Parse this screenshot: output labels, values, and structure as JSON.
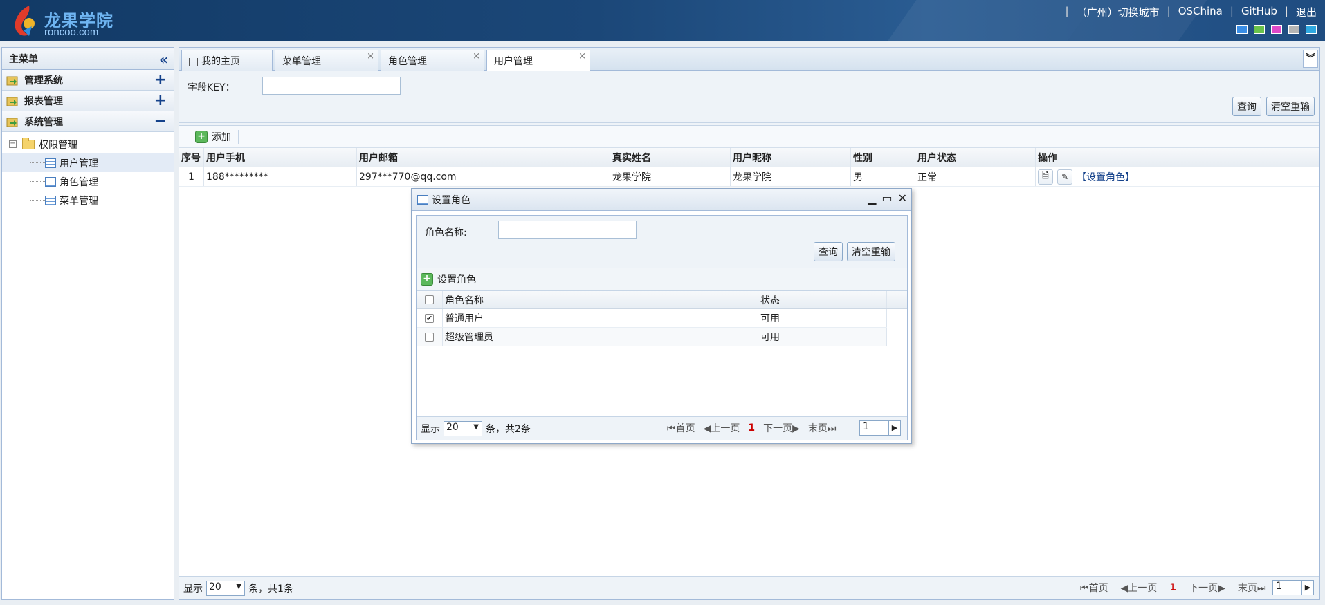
{
  "header": {
    "logo_cn": "龙果学院",
    "logo_en": "roncoo.com",
    "nav": [
      "（广州）切换城市",
      "OSChina",
      "GitHub",
      "退出"
    ],
    "theme_colors": [
      "#3a8ee6",
      "#6ac24b",
      "#e04ac9",
      "#b5b5b5",
      "#2fa8e0"
    ]
  },
  "sidebar": {
    "title": "主菜单",
    "groups": [
      {
        "label": "管理系统",
        "toggle": "+"
      },
      {
        "label": "报表管理",
        "toggle": "+"
      },
      {
        "label": "系统管理",
        "toggle": "−"
      }
    ],
    "tree_root": "权限管理",
    "tree_items": [
      "用户管理",
      "角色管理",
      "菜单管理"
    ]
  },
  "tabs": [
    {
      "label": "我的主页",
      "icon": "home-icon"
    },
    {
      "label": "菜单管理",
      "close": "×"
    },
    {
      "label": "角色管理",
      "close": "×"
    },
    {
      "label": "用户管理",
      "close": "×"
    }
  ],
  "search": {
    "field_label": "字段KEY：",
    "query_button": "查询",
    "reset_button": "清空重输"
  },
  "toolbar": {
    "add_label": "添加"
  },
  "user_grid": {
    "columns": [
      "序号",
      "用户手机",
      "用户邮箱",
      "真实姓名",
      "用户昵称",
      "性别",
      "用户状态",
      "操作"
    ],
    "rows": [
      {
        "index": "1",
        "phone": "188*********",
        "email": "297***770@qq.com",
        "real_name": "龙果学院",
        "nickname": "龙果学院",
        "gender": "男",
        "status": "正常",
        "action_link": "【设置角色】"
      }
    ]
  },
  "main_pager": {
    "show": "显示",
    "page_size": "20",
    "summary": "条，共1条",
    "first": "首页",
    "prev": "上一页",
    "current": "1",
    "next": "下一页",
    "last": "末页",
    "page_input": "1"
  },
  "dialog": {
    "title": "设置角色",
    "role_name_label": "角色名称:",
    "query_button": "查询",
    "reset_button": "清空重输",
    "toolbar_label": "设置角色",
    "columns": [
      "角色名称",
      "状态"
    ],
    "rows": [
      {
        "name": "普通用户",
        "status": "可用",
        "checked": true
      },
      {
        "name": "超级管理员",
        "status": "可用",
        "checked": false
      }
    ],
    "pager": {
      "show": "显示",
      "page_size": "20",
      "summary": "条，共2条",
      "first": "首页",
      "prev": "上一页",
      "current": "1",
      "next": "下一页",
      "last": "末页",
      "page_input": "1"
    }
  }
}
